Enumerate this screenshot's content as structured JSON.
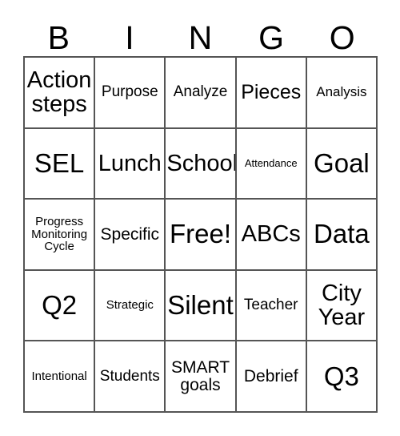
{
  "card": {
    "header_letters": [
      "B",
      "I",
      "N",
      "G",
      "O"
    ],
    "rows": [
      [
        {
          "text": "Action\nsteps",
          "size": "xl"
        },
        {
          "text": "Purpose",
          "size": "m"
        },
        {
          "text": "Analyze",
          "size": "m"
        },
        {
          "text": "Pieces",
          "size": "l"
        },
        {
          "text": "Analysis",
          "size": "sm"
        }
      ],
      [
        {
          "text": "SEL",
          "size": "xxl"
        },
        {
          "text": "Lunch",
          "size": "xl"
        },
        {
          "text": "School",
          "size": "xl"
        },
        {
          "text": "Attendance",
          "size": "xs"
        },
        {
          "text": "Goal",
          "size": "xxl"
        }
      ],
      [
        {
          "text": "Progress\nMonitoring\nCycle",
          "size": "s"
        },
        {
          "text": "Specific",
          "size": "ml"
        },
        {
          "text": "Free!",
          "size": "xxl"
        },
        {
          "text": "ABCs",
          "size": "xl"
        },
        {
          "text": "Data",
          "size": "xxl"
        }
      ],
      [
        {
          "text": "Q2",
          "size": "xxl"
        },
        {
          "text": "Strategic",
          "size": "s"
        },
        {
          "text": "Silent",
          "size": "xxl"
        },
        {
          "text": "Teacher",
          "size": "m"
        },
        {
          "text": "City\nYear",
          "size": "xl"
        }
      ],
      [
        {
          "text": "Intentional",
          "size": "s"
        },
        {
          "text": "Students",
          "size": "m"
        },
        {
          "text": "SMART\ngoals",
          "size": "ml"
        },
        {
          "text": "Debrief",
          "size": "ml"
        },
        {
          "text": "Q3",
          "size": "xxl"
        }
      ]
    ]
  },
  "colors": {
    "background": "#ffffff",
    "text": "#000000",
    "grid_line": "#555555"
  }
}
